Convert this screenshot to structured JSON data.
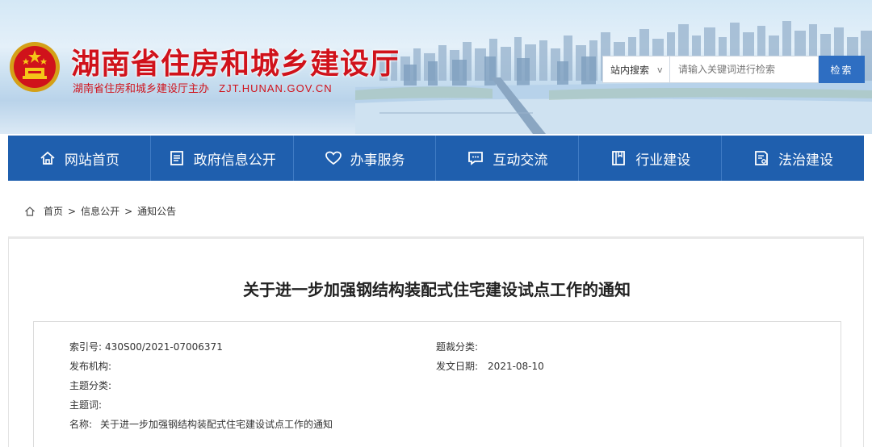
{
  "header": {
    "title": "湖南省住房和城乡建设厅",
    "subtitle": "湖南省住房和城乡建设厅主办",
    "url": "ZJT.HUNAN.GOV.CN",
    "emblem_icon": "national-emblem-icon"
  },
  "search": {
    "scope": "站内搜索",
    "scope_chevron": "v",
    "placeholder": "请输入关键词进行检索",
    "button": "检索"
  },
  "nav": {
    "items": [
      {
        "label": "网站首页",
        "icon": "home-icon"
      },
      {
        "label": "政府信息公开",
        "icon": "document-list-icon"
      },
      {
        "label": "办事服务",
        "icon": "heart-icon"
      },
      {
        "label": "互动交流",
        "icon": "chat-icon"
      },
      {
        "label": "行业建设",
        "icon": "book-icon"
      },
      {
        "label": "法治建设",
        "icon": "law-document-icon"
      }
    ]
  },
  "breadcrumb": {
    "items": [
      "首页",
      "信息公开",
      "通知公告"
    ],
    "separator": ">"
  },
  "article": {
    "title": "关于进一步加强钢结构装配式住宅建设试点工作的通知",
    "meta": {
      "index_label": "索引号:",
      "index_value": "430S00/2021-07006371",
      "category_label": "题裁分类:",
      "category_value": "",
      "org_label": "发布机构:",
      "org_value": "",
      "date_label": "发文日期:",
      "date_value": "2021-08-10",
      "topic_label": "主题分类:",
      "topic_value": "",
      "keywords_label": "主题词:",
      "keywords_value": "",
      "name_label": "名称:",
      "name_value": "关于进一步加强钢结构装配式住宅建设试点工作的通知"
    }
  },
  "colors": {
    "brand_red": "#d0121b",
    "nav_blue": "#1f5fae",
    "button_blue": "#2e6ec2"
  }
}
